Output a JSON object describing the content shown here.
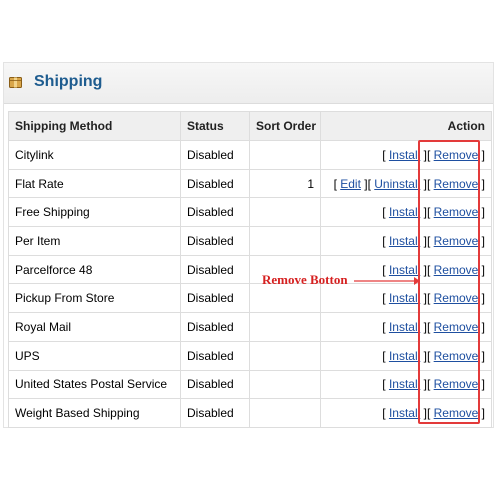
{
  "section": {
    "title": "Shipping",
    "icon": "package-icon"
  },
  "table": {
    "headers": {
      "method": "Shipping Method",
      "status": "Status",
      "sort_order": "Sort Order",
      "action": "Action"
    },
    "rows": [
      {
        "method": "Citylink",
        "status": "Disabled",
        "sort_order": "",
        "actions": [
          "Install",
          "Remove"
        ]
      },
      {
        "method": "Flat Rate",
        "status": "Disabled",
        "sort_order": "1",
        "actions": [
          "Edit",
          "Uninstall",
          "Remove"
        ]
      },
      {
        "method": "Free Shipping",
        "status": "Disabled",
        "sort_order": "",
        "actions": [
          "Install",
          "Remove"
        ]
      },
      {
        "method": "Per Item",
        "status": "Disabled",
        "sort_order": "",
        "actions": [
          "Install",
          "Remove"
        ]
      },
      {
        "method": "Parcelforce 48",
        "status": "Disabled",
        "sort_order": "",
        "actions": [
          "Install",
          "Remove"
        ]
      },
      {
        "method": "Pickup From Store",
        "status": "Disabled",
        "sort_order": "",
        "actions": [
          "Install",
          "Remove"
        ]
      },
      {
        "method": "Royal Mail",
        "status": "Disabled",
        "sort_order": "",
        "actions": [
          "Install",
          "Remove"
        ]
      },
      {
        "method": "UPS",
        "status": "Disabled",
        "sort_order": "",
        "actions": [
          "Install",
          "Remove"
        ]
      },
      {
        "method": "United States Postal Service",
        "status": "Disabled",
        "sort_order": "",
        "actions": [
          "Install",
          "Remove"
        ]
      },
      {
        "method": "Weight Based Shipping",
        "status": "Disabled",
        "sort_order": "",
        "actions": [
          "Install",
          "Remove"
        ]
      }
    ]
  },
  "annotation": {
    "text": "Remove Botton",
    "color": "#e33a3a"
  },
  "colors": {
    "title": "#1e5c8f",
    "link": "#1e4fa0"
  }
}
